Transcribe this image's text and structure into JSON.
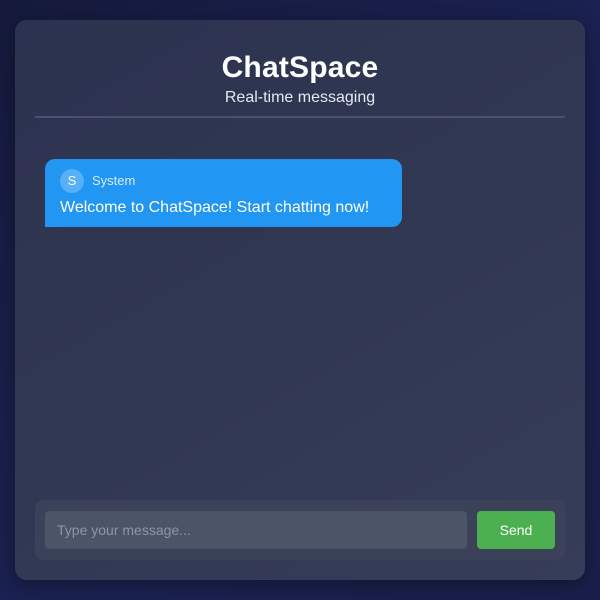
{
  "header": {
    "title": "ChatSpace",
    "subtitle": "Real-time messaging"
  },
  "messages": [
    {
      "avatar_initial": "S",
      "sender": "System",
      "text": "Welcome to ChatSpace! Start chatting now!"
    }
  ],
  "composer": {
    "placeholder": "Type your message...",
    "value": "",
    "send_label": "Send"
  },
  "colors": {
    "message_bubble": "#2196f3",
    "send_button": "#4caf50"
  }
}
